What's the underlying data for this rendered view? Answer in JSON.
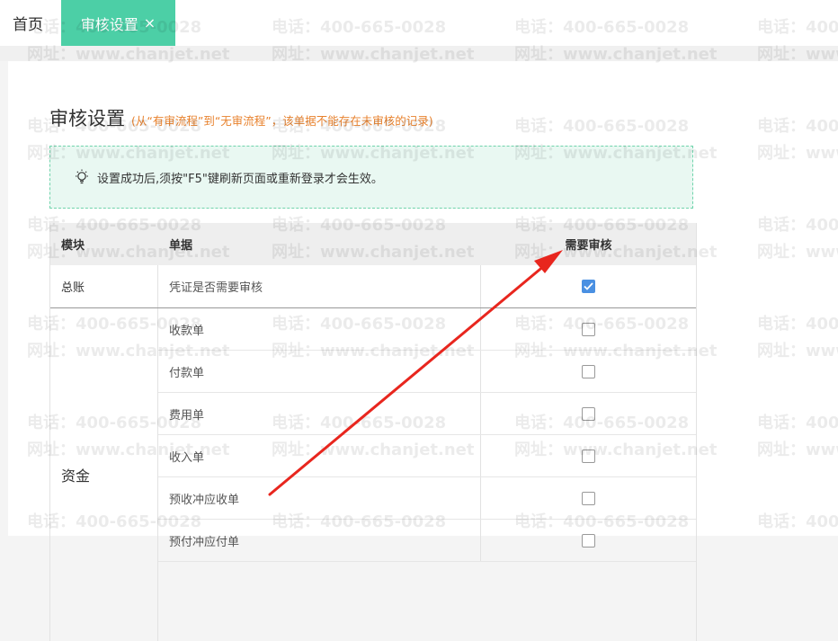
{
  "tabs": {
    "home": "首页",
    "active": "审核设置",
    "close": "×"
  },
  "page": {
    "title": "审核设置",
    "subtitle": "(从“有审流程”到“无审流程”，该单据不能存在未审核的记录)",
    "tip": "设置成功后,须按\"F5\"键刷新页面或重新登录才会生效。"
  },
  "table": {
    "headers": {
      "module": "模块",
      "document": "单据",
      "review": "需要审核"
    },
    "general": {
      "module": "总账",
      "document": "凭证是否需要审核",
      "checked": true
    },
    "fund": {
      "module": "资金",
      "rows": [
        {
          "document": "收款单",
          "checked": false
        },
        {
          "document": "付款单",
          "checked": false
        },
        {
          "document": "费用单",
          "checked": false
        },
        {
          "document": "收入单",
          "checked": false
        },
        {
          "document": "预收冲应收单",
          "checked": false
        },
        {
          "document": "预付冲应付单",
          "checked": false
        }
      ]
    }
  },
  "watermark": {
    "phone": "电话：400-665-0028",
    "site": "网址：www.chanjet.net"
  },
  "colors": {
    "accent": "#4ccfa6",
    "subtitle": "#e8822e",
    "checkbox": "#4a90e2",
    "arrow": "#e8261e"
  }
}
